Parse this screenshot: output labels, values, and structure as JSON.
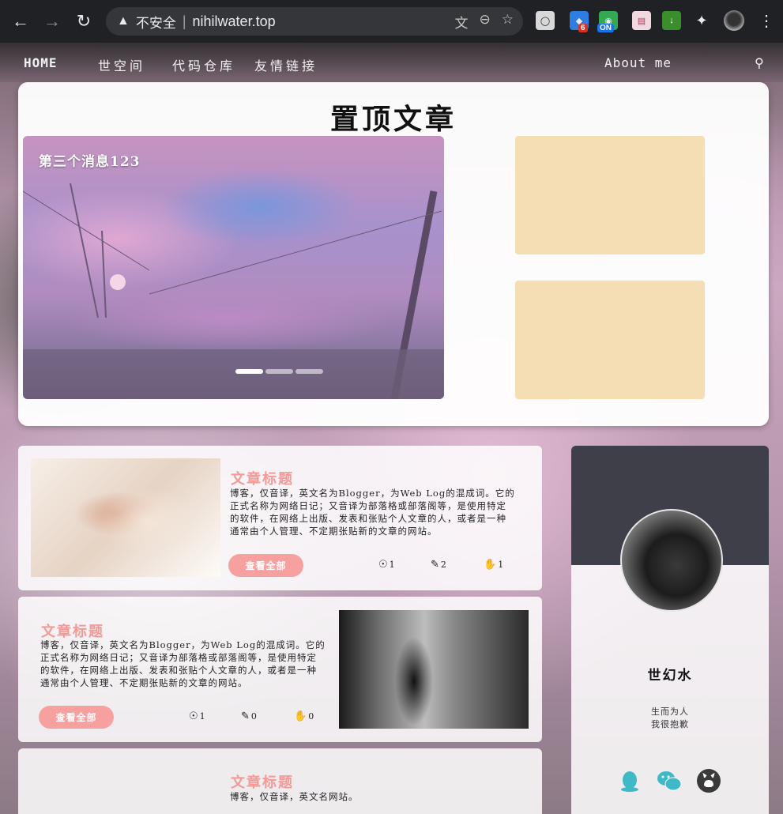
{
  "browser": {
    "security_label": "不安全",
    "url": "nihilwater.top",
    "extensions": [
      {
        "name": "toggle-extension",
        "badge": ""
      },
      {
        "name": "extension-6",
        "badge": "6"
      },
      {
        "name": "extension-on",
        "badge": "ON"
      },
      {
        "name": "reader-extension",
        "badge": ""
      },
      {
        "name": "download-extension",
        "badge": ""
      }
    ]
  },
  "nav": {
    "home": "HOME",
    "world": "世空间",
    "repo": "代码仓库",
    "links": "友情链接",
    "about": "About me"
  },
  "top": {
    "heading": "置顶文章",
    "carousel_caption": "第三个消息123",
    "slides": 3,
    "active_slide": 0
  },
  "articles": [
    {
      "title": "文章标题",
      "text": "博客，仅音译，英文名为Blogger，为Web Log的混成词。它的正式名称为网络日记；又音译为部落格或部落阁等，是使用特定的软件，在网络上出版、发表和张贴个人文章的人，或者是一种通常由个人管理、不定期张贴新的文章的网站。",
      "button": "查看全部",
      "views": "1",
      "comments": "2",
      "likes": "1"
    },
    {
      "title": "文章标题",
      "text": "博客，仅音译，英文名为Blogger，为Web Log的混成词。它的正式名称为网络日记；又音译为部落格或部落阁等，是使用特定的软件，在网络上出版、发表和张贴个人文章的人，或者是一种通常由个人管理、不定期张贴新的文章的网站。",
      "button": "查看全部",
      "views": "1",
      "comments": "0",
      "likes": "0"
    },
    {
      "title": "文章标题",
      "text": "博客，仅音译，英文名网站。"
    }
  ],
  "profile": {
    "name": "世幻水",
    "motto_1": "生而为人",
    "motto_2": "我很抱歉",
    "social": [
      "qq-icon",
      "wechat-icon",
      "github-icon"
    ]
  },
  "colors": {
    "accent": "#f29a98",
    "button": "#f6a0a0",
    "placeholder": "#f5deb3",
    "profile_band": "#3e3f48"
  }
}
